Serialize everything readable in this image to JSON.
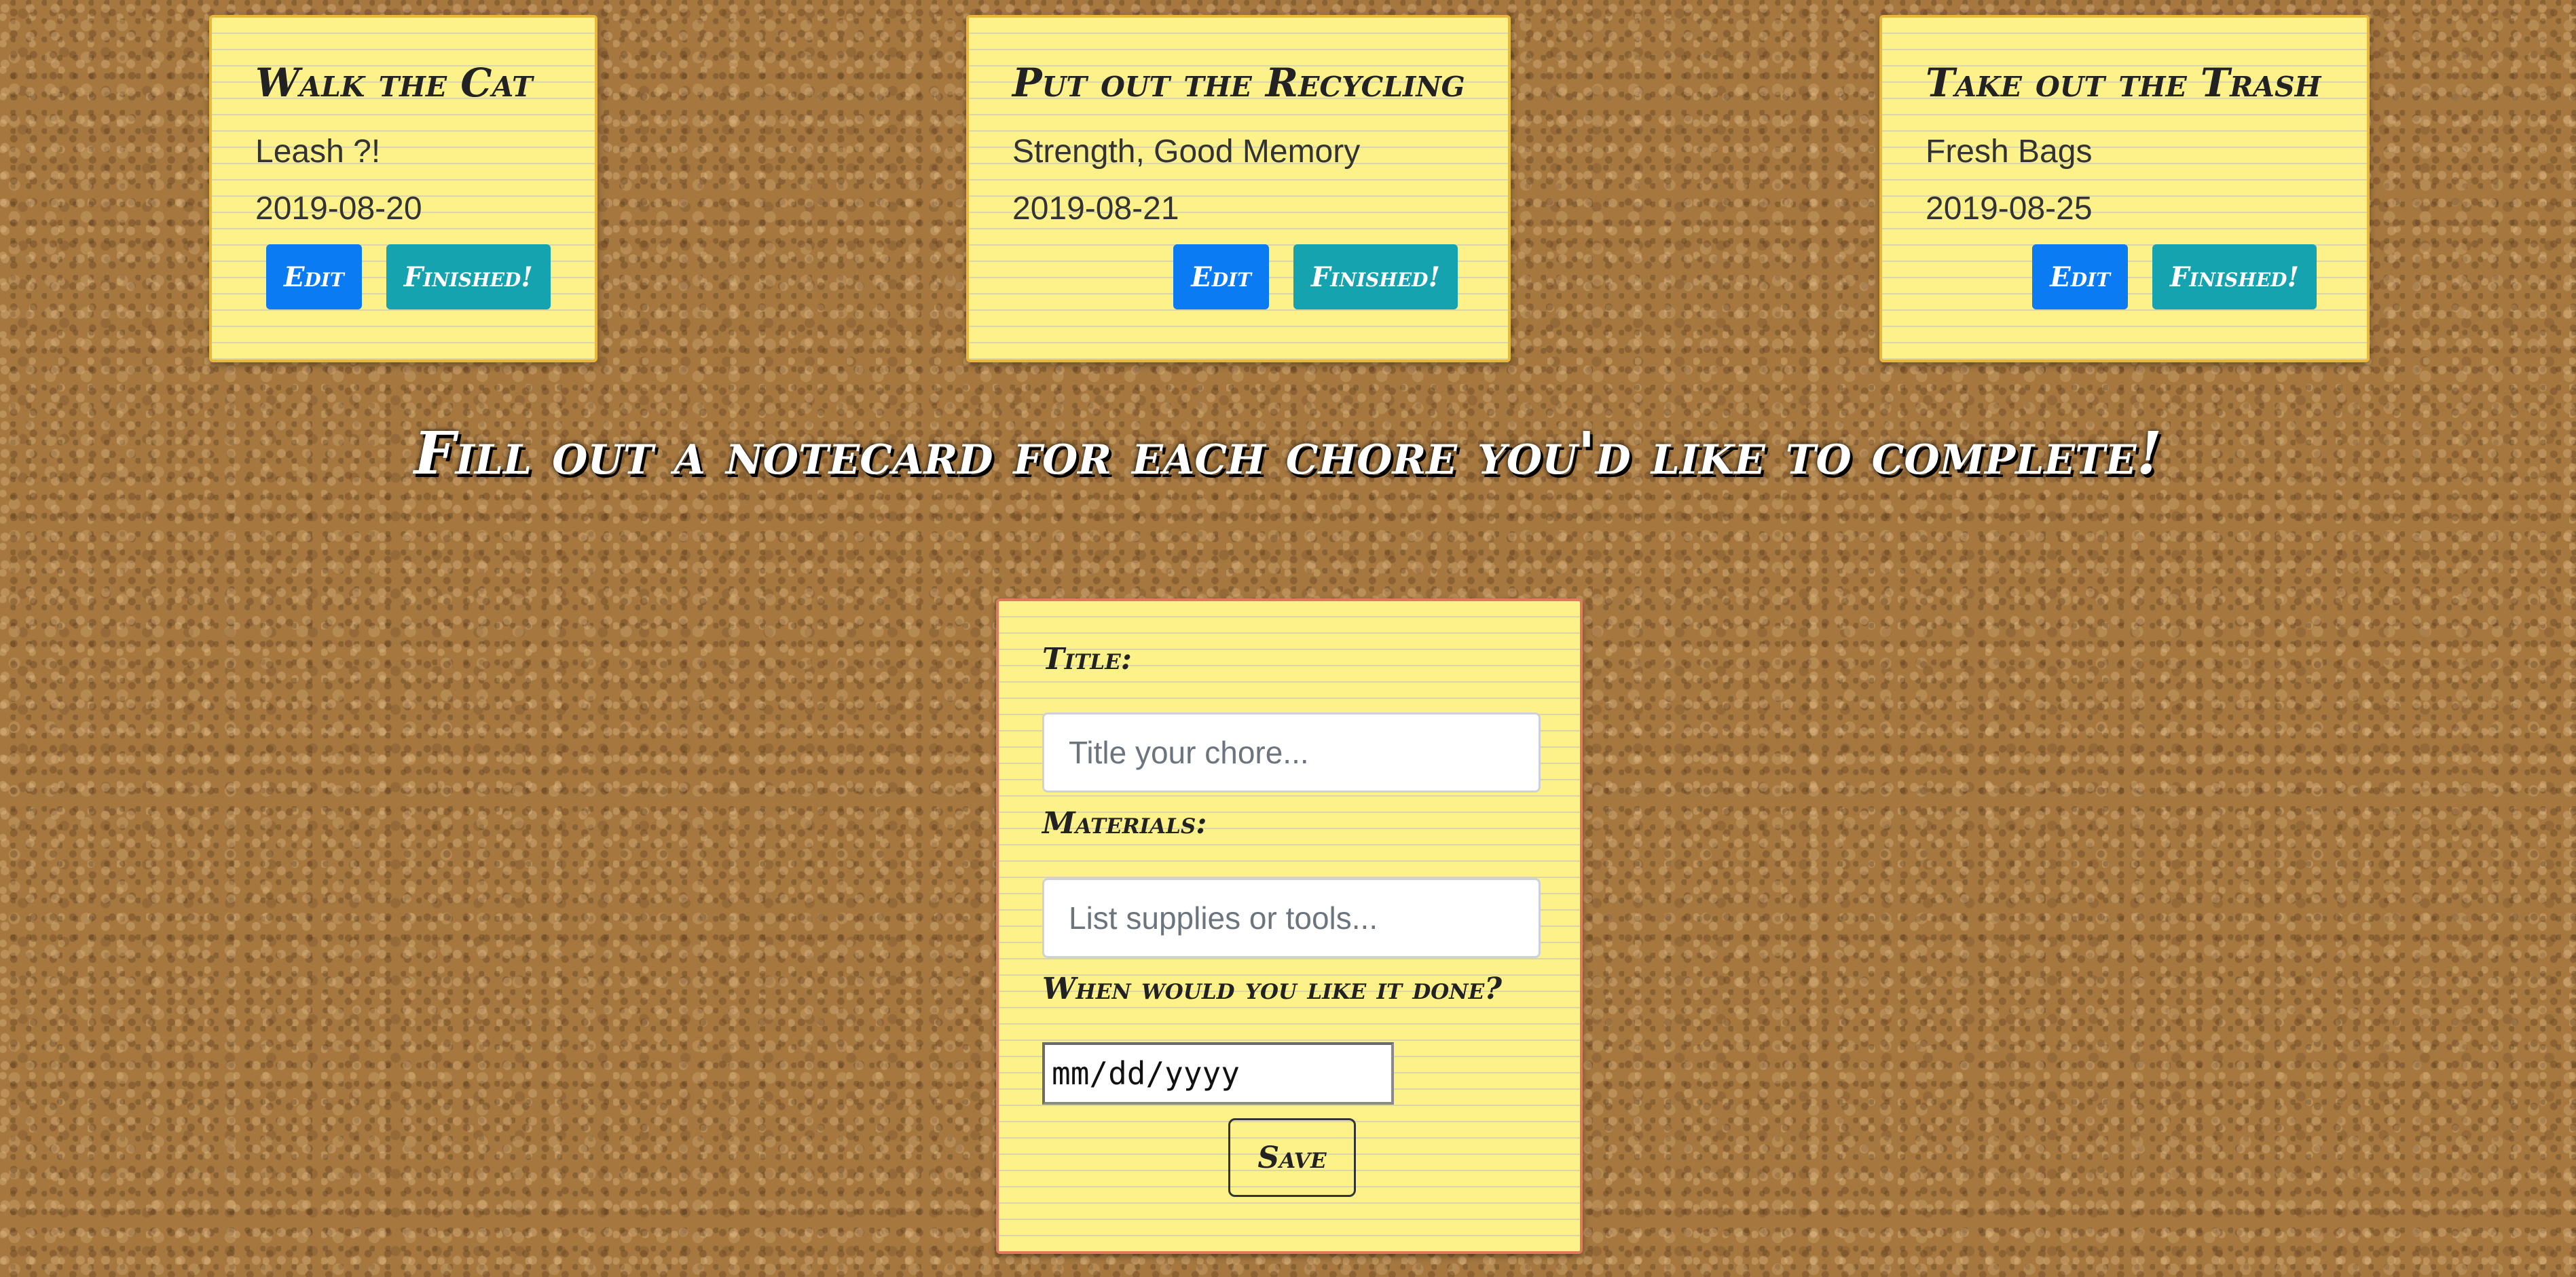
{
  "chores": [
    {
      "title": "Walk the Cat",
      "materials": "Leash ?!",
      "date": "2019-08-20",
      "edit_label": "Edit",
      "finished_label": "Finished!"
    },
    {
      "title": "Put out the Recycling",
      "materials": "Strength, Good Memory",
      "date": "2019-08-21",
      "edit_label": "Edit",
      "finished_label": "Finished!"
    },
    {
      "title": "Take out the Trash",
      "materials": "Fresh Bags",
      "date": "2019-08-25",
      "edit_label": "Edit",
      "finished_label": "Finished!"
    }
  ],
  "instructions": "Fill out a notecard for each chore you'd like to complete!",
  "form": {
    "title_label": "Title:",
    "title_placeholder": "Title your chore...",
    "materials_label": "Materials:",
    "materials_placeholder": "List supplies or tools...",
    "date_label": "When would you like it done?",
    "date_placeholder": "mm/dd/yyyy",
    "save_label": "Save"
  },
  "colors": {
    "notecard": "#fdf28a",
    "edit_button": "#0b7bf4",
    "finished_button": "#16a3b0",
    "corkboard": "#a67840"
  }
}
